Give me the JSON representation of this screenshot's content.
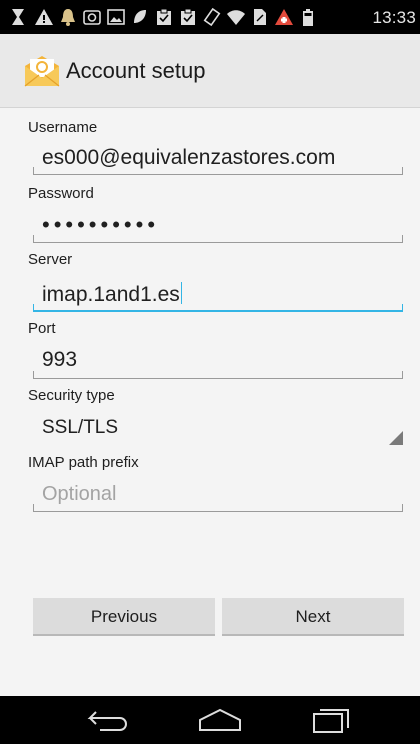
{
  "status_bar": {
    "time": "13:33",
    "icons": [
      "usb-icon",
      "warning-icon",
      "bell-icon",
      "camera-icon",
      "image-icon",
      "leaf-icon",
      "clipboard-icon",
      "clipboard-icon",
      "rotate-icon",
      "wifi-icon",
      "sim-icon",
      "alert-icon",
      "battery-icon"
    ]
  },
  "action_bar": {
    "icon": "email-app-icon",
    "title": "Account setup"
  },
  "form": {
    "username": {
      "label": "Username",
      "value": "es000@equivalenzastores.com"
    },
    "password": {
      "label": "Password",
      "value": "••••••••••"
    },
    "server": {
      "label": "Server",
      "value": "imap.1and1.es"
    },
    "port": {
      "label": "Port",
      "value": "993"
    },
    "security": {
      "label": "Security type",
      "value": "SSL/TLS"
    },
    "prefix": {
      "label": "IMAP path prefix",
      "placeholder": "Optional"
    }
  },
  "buttons": {
    "previous": "Previous",
    "next": "Next"
  },
  "colors": {
    "accent": "#33b5e5",
    "background": "#f4f4f4",
    "action_bar": "#e9e9e9"
  },
  "nav_bar": {
    "icons": [
      "back-icon",
      "home-icon",
      "recents-icon"
    ]
  }
}
